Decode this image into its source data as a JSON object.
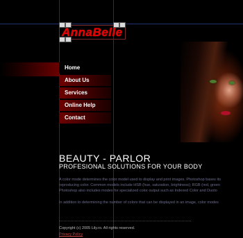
{
  "logo": {
    "text": "AnnaBelle"
  },
  "nav": {
    "items": [
      {
        "label": "Home"
      },
      {
        "label": "About Us"
      },
      {
        "label": "Services"
      },
      {
        "label": "Online Help"
      },
      {
        "label": "Contact"
      }
    ]
  },
  "content": {
    "title": "BEAUTY - PARLOR",
    "subtitle": "PROFESIONAL SOLUTIONS FOR YOUR BODY",
    "paragraphs": [
      "A color mode determines the color model used to display and print images. Photoshop bases its",
      "reproducing color. Common models include HSB (hue, saturation, brightness); RGB (red, green",
      "Photoshop also includes modes for specialized color output such as Indexed Color and Duoto",
      "In addition to determining the number of colors that can be displayed in an image, color modes"
    ]
  },
  "footer": {
    "copyright": "Copyright (c) 2005 Lily.ro. All rights reserved.",
    "privacy": "Privacy Policy"
  },
  "colors": {
    "background": "#000000",
    "accent": "#e60000",
    "nav_gradient": "#6e0000",
    "guide": "#1e2f6e"
  }
}
